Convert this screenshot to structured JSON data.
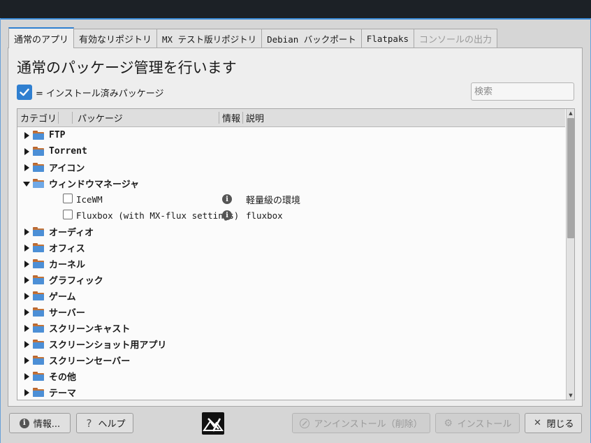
{
  "tabs": [
    {
      "label": "通常のアプリ",
      "active": true,
      "disabled": false,
      "mono": false
    },
    {
      "label": "有効なリポジトリ",
      "active": false,
      "disabled": false,
      "mono": false
    },
    {
      "label": "MX テスト版リポジトリ",
      "active": false,
      "disabled": false,
      "mono": true
    },
    {
      "label": "Debian バックポート",
      "active": false,
      "disabled": false,
      "mono": true
    },
    {
      "label": "Flatpaks",
      "active": false,
      "disabled": false,
      "mono": true
    },
    {
      "label": "コンソールの出力",
      "active": false,
      "disabled": true,
      "mono": false
    }
  ],
  "main": {
    "heading": "通常のパッケージ管理を行います",
    "legend_text": "= インストール済みパッケージ",
    "search_placeholder": "検索"
  },
  "columns": {
    "category": "カテゴリ",
    "package": "パッケージ",
    "info": "情報",
    "description": "説明"
  },
  "rows": [
    {
      "kind": "category",
      "label": "FTP",
      "expanded": false,
      "mono": true
    },
    {
      "kind": "category",
      "label": "Torrent",
      "expanded": false,
      "mono": true
    },
    {
      "kind": "category",
      "label": "アイコン",
      "expanded": false,
      "mono": false
    },
    {
      "kind": "category",
      "label": "ウィンドウマネージャ",
      "expanded": true,
      "mono": false
    },
    {
      "kind": "package",
      "name": "IceWM",
      "description": "軽量級の環境",
      "desc_mono": false,
      "installed": false
    },
    {
      "kind": "package",
      "name": "Fluxbox (with MX-flux settings)",
      "description": "fluxbox",
      "desc_mono": true,
      "installed": false
    },
    {
      "kind": "category",
      "label": "オーディオ",
      "expanded": false,
      "mono": false
    },
    {
      "kind": "category",
      "label": "オフィス",
      "expanded": false,
      "mono": false
    },
    {
      "kind": "category",
      "label": "カーネル",
      "expanded": false,
      "mono": false
    },
    {
      "kind": "category",
      "label": "グラフィック",
      "expanded": false,
      "mono": false
    },
    {
      "kind": "category",
      "label": "ゲーム",
      "expanded": false,
      "mono": false
    },
    {
      "kind": "category",
      "label": "サーバー",
      "expanded": false,
      "mono": false
    },
    {
      "kind": "category",
      "label": "スクリーンキャスト",
      "expanded": false,
      "mono": false
    },
    {
      "kind": "category",
      "label": "スクリーンショット用アプリ",
      "expanded": false,
      "mono": false
    },
    {
      "kind": "category",
      "label": "スクリーンセーバー",
      "expanded": false,
      "mono": false
    },
    {
      "kind": "category",
      "label": "その他",
      "expanded": false,
      "mono": false
    },
    {
      "kind": "category",
      "label": "テーマ",
      "expanded": false,
      "mono": false
    }
  ],
  "buttons": {
    "info": "情報...",
    "help": "ヘルプ",
    "uninstall": "アンインストール（削除）",
    "install": "インストール",
    "close": "閉じる"
  },
  "icons": {
    "info": "info-circle-icon",
    "help": "question-mark-icon",
    "uninstall": "no-entry-icon",
    "install": "gear-icon",
    "close": "close-x-icon",
    "logo": "mx-linux-logo"
  },
  "colors": {
    "accent": "#2f7fd0",
    "folder_blue": "#4c8fd6",
    "folder_orange": "#c47438"
  }
}
